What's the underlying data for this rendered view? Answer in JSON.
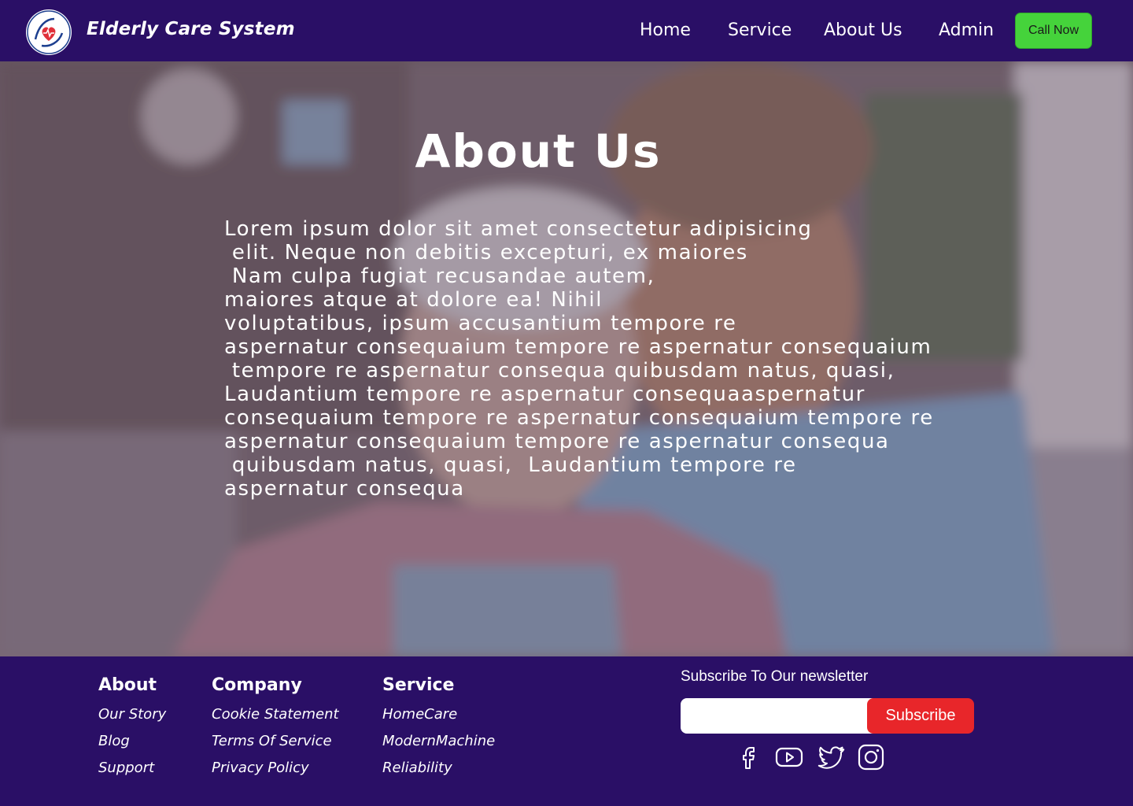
{
  "header": {
    "brand": "Elderly Care System",
    "nav": [
      "Home",
      "Service",
      "About Us",
      "Admin"
    ],
    "call_button": "Call Now"
  },
  "hero": {
    "title": "About Us",
    "body": "Lorem ipsum dolor sit amet consectetur adipisicing\n elit. Neque non debitis excepturi, ex maiores\n Nam culpa fugiat recusandae autem,\nmaiores atque at dolore ea! Nihil\nvoluptatibus, ipsum accusantium tempore re\naspernatur consequaium tempore re aspernatur consequaium\n tempore re aspernatur consequa quibusdam natus, quasi,\nLaudantium tempore re aspernatur consequaaspernatur\nconsequaium tempore re aspernatur consequaium tempore re\naspernatur consequaium tempore re aspernatur consequa\n quibusdam natus, quasi,  Laudantium tempore re\naspernatur consequa"
  },
  "footer": {
    "about": {
      "title": "About",
      "links": [
        "Our Story",
        "Blog",
        "Support"
      ]
    },
    "company": {
      "title": "Company",
      "links": [
        "Cookie Statement",
        "Terms Of Service",
        "Privacy Policy"
      ]
    },
    "service": {
      "title": "Service",
      "links": [
        "HomeCare",
        "ModernMachine",
        "Reliability"
      ]
    },
    "newsletter": {
      "label": "Subscribe To Our newsletter",
      "placeholder": "",
      "button": "Subscribe"
    },
    "social": [
      "facebook-icon",
      "youtube-icon",
      "twitter-icon",
      "instagram-icon"
    ]
  },
  "colors": {
    "primary": "#2a0f66",
    "call_button": "#45d33b",
    "subscribe_button": "#e8262a"
  }
}
